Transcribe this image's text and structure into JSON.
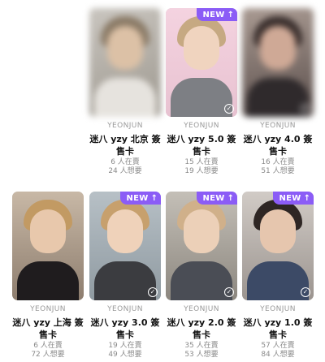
{
  "cards": [
    {
      "artist": "YEONJUN",
      "title": "迷八 yzy 北京 簽售卡",
      "selling": "6 人在賣",
      "wanting": "24 人想要",
      "is_new": false
    },
    {
      "artist": "YEONJUN",
      "title": "迷八 yzy 5.0 簽售卡",
      "selling": "15 人在賣",
      "wanting": "19 人想要",
      "is_new": true
    },
    {
      "artist": "YEONJUN",
      "title": "迷八 yzy 4.0 簽售卡",
      "selling": "16 人在賣",
      "wanting": "51 人想要",
      "is_new": false
    },
    {
      "artist": "YEONJUN",
      "title": "迷八 yzy 上海 簽售卡",
      "selling": "6 人在賣",
      "wanting": "72 人想要",
      "is_new": false
    },
    {
      "artist": "YEONJUN",
      "title": "迷八 yzy 3.0 簽售卡",
      "selling": "19 人在賣",
      "wanting": "49 人想要",
      "is_new": true
    },
    {
      "artist": "YEONJUN",
      "title": "迷八 yzy 2.0 簽售卡",
      "selling": "35 人在賣",
      "wanting": "53 人想要",
      "is_new": true
    },
    {
      "artist": "YEONJUN",
      "title": "迷八 yzy 1.0 簽售卡",
      "selling": "57 人在賣",
      "wanting": "84 人想要",
      "is_new": true
    }
  ],
  "badge": {
    "label": "NEW",
    "arrow": "↑"
  },
  "colors": {
    "accent": "#8b5cf6",
    "text": "#111111",
    "muted": "#9a9a9a"
  },
  "icons": {
    "new": "arrow-up-icon",
    "owned": "check-circle-icon"
  }
}
